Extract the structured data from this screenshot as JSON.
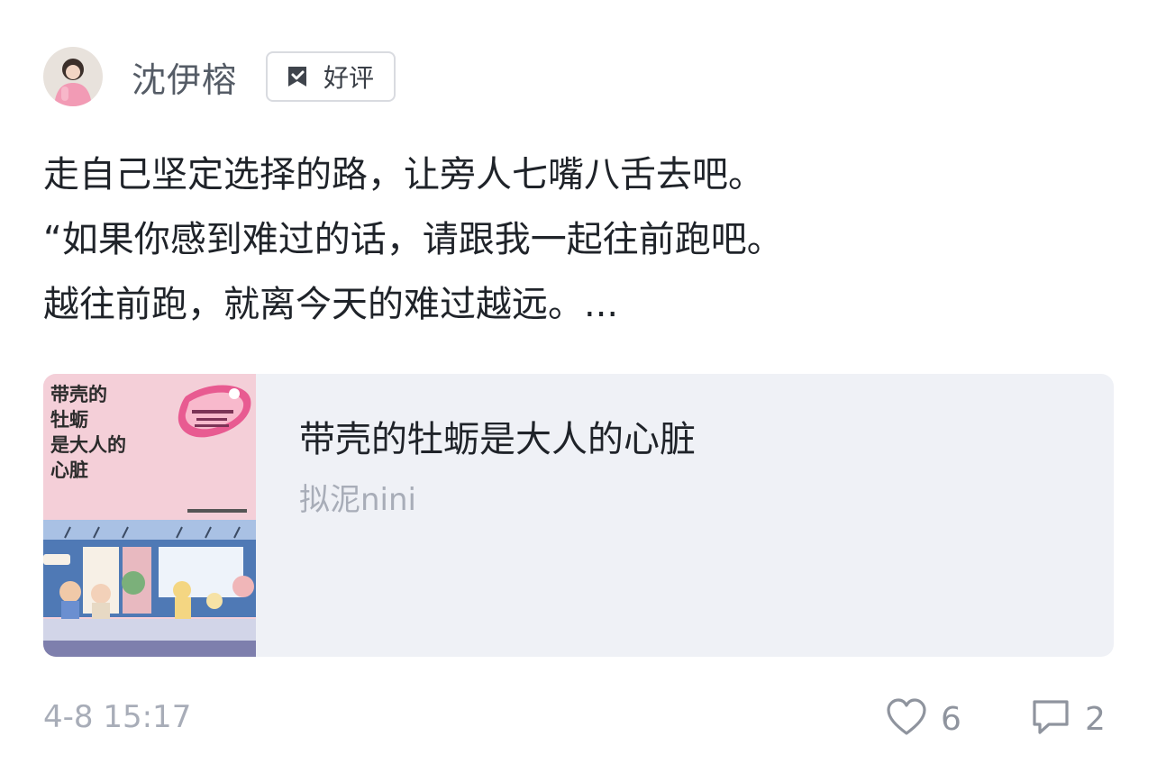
{
  "post": {
    "author": {
      "name": "沈伊榕",
      "avatar_icon": "user-avatar"
    },
    "rating": {
      "label": "好评",
      "icon": "thumbs-up-check-icon"
    },
    "lines": [
      "走自己坚定选择的路，让旁人七嘴八舌去吧。",
      "“如果你感到难过的话，请跟我一起往前跑吧。",
      "越往前跑，就离今天的难过越远。..."
    ],
    "book": {
      "title": "带壳的牡蛎是大人的心脏",
      "author": "拟泥nini",
      "cover_title_lines": [
        "带壳的",
        "牡蛎",
        "是大人的",
        "心脏"
      ]
    },
    "timestamp": "4-8 15:17",
    "likes": "6",
    "comments": "2"
  },
  "colors": {
    "text_primary": "#1f2329",
    "text_secondary": "#a8adb8",
    "card_bg": "#eff1f6",
    "cover_pink": "#f4cfd8",
    "cover_blue": "#4f79b5"
  }
}
